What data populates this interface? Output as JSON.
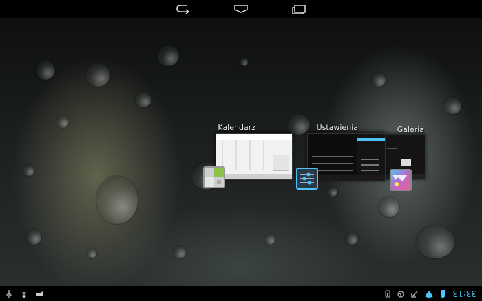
{
  "status_bar": {
    "time": "33:13",
    "left_icons": [
      "clock",
      "battery-icon",
      "wifi-icon",
      "signal-icon"
    ],
    "right_icons": [
      "usb-icon",
      "debug-icon",
      "keyboard-icon"
    ]
  },
  "navigation": {
    "buttons": [
      "back",
      "home",
      "recent-apps"
    ]
  },
  "recent_apps": [
    {
      "title": "Galeria",
      "icon": "gallery-icon"
    },
    {
      "title": "Ustawienia",
      "icon": "settings-icon"
    },
    {
      "title": "Kalendarz",
      "icon": "calendar-icon"
    }
  ],
  "colors": {
    "accent": "#4fc3f7",
    "background": "#000000"
  }
}
